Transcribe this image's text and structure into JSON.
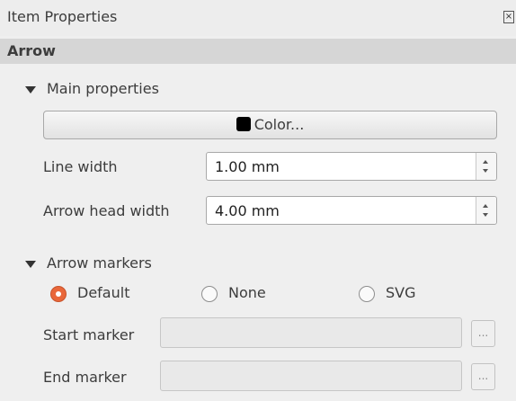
{
  "window": {
    "title": "Item Properties",
    "close_glyph": "×"
  },
  "section": {
    "title": "Arrow"
  },
  "main_properties": {
    "header": "Main properties",
    "color_button_label": "Color...",
    "color_value": "#000000",
    "line_width_label": "Line width",
    "line_width_value": "1.00 mm",
    "arrow_head_width_label": "Arrow head width",
    "arrow_head_width_value": "4.00 mm"
  },
  "arrow_markers": {
    "header": "Arrow markers",
    "options": [
      "Default",
      "None",
      "SVG"
    ],
    "selected": "Default",
    "start_marker_label": "Start marker",
    "start_marker_value": "",
    "end_marker_label": "End marker",
    "end_marker_value": "",
    "browse_label": "..."
  },
  "colors": {
    "accent": "#e9673a",
    "section_header_bg": "#d6d6d6",
    "background": "#efefef"
  }
}
